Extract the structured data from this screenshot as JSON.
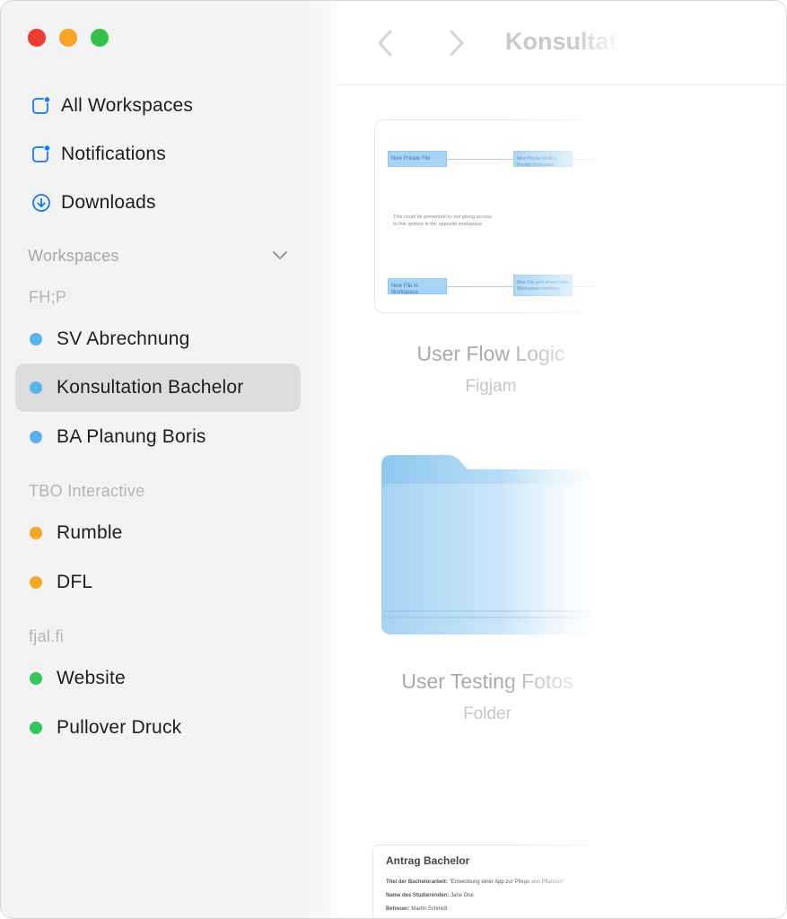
{
  "window": {
    "traffic_lights": [
      "close",
      "minimize",
      "maximize"
    ]
  },
  "sidebar": {
    "nav": [
      {
        "label": "All Workspaces",
        "icon": "square-badge-icon"
      },
      {
        "label": "Notifications",
        "icon": "square-badge-icon"
      },
      {
        "label": "Downloads",
        "icon": "download-circle-icon"
      }
    ],
    "section_title": "Workspaces",
    "groups": [
      {
        "label": "FH;P",
        "color": "#5ab4ec",
        "items": [
          "SV Abrechnung",
          "Konsultation Bachelor",
          "BA Planung Boris"
        ]
      },
      {
        "label": "TBO Interactive",
        "color": "#f5a623",
        "items": [
          "Rumble",
          "DFL"
        ]
      },
      {
        "label": "fjal.fi",
        "color": "#34c759",
        "items": [
          "Website",
          "Pullover Druck"
        ]
      }
    ],
    "selected": "Konsultation Bachelor"
  },
  "main": {
    "title": "Konsultation Bachelor",
    "files": [
      {
        "name": "User Flow Logic",
        "type": "Figjam",
        "preview": {
          "box1": "New Private File",
          "box2": "New Private Draft in Private Workspace",
          "note": "This could be prevented by not giving access to this options in the opposite workspace",
          "box3": "New File in Workspace",
          "box4": "New File gets shared with Workspace members"
        }
      },
      {
        "name": "User Testing Fotos",
        "type": "Folder"
      },
      {
        "name": "Antrag Bachelor",
        "preview": {
          "title": "Antrag Bachelor",
          "lines": [
            {
              "label": "Titel der Bachelorarbeit:",
              "value": "\"Entwicklung einer App zur Pflege von Pflanzen\""
            },
            {
              "label": "Name des Studierenden:",
              "value": "Jane Doe"
            },
            {
              "label": "Betreuer:",
              "value": "Martin Schmidt"
            }
          ]
        }
      }
    ]
  },
  "colors": {
    "sidebar_bg": "#f3f3f3",
    "selected_bg": "#dcdcdc",
    "accent_blue": "#0a7cff"
  }
}
